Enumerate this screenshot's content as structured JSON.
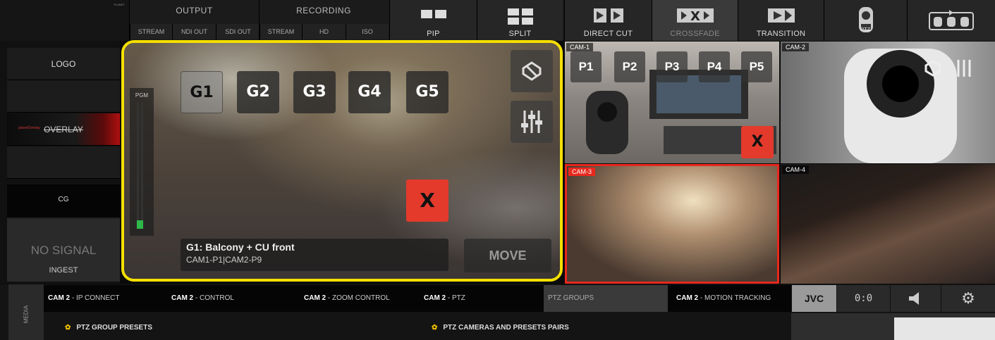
{
  "topbar": {
    "brand": "PLANET",
    "output": {
      "title": "OUTPUT",
      "buttons": [
        "STREAM",
        "NDI OUT",
        "SDI OUT"
      ]
    },
    "recording": {
      "title": "RECORDING",
      "buttons": [
        "STREAM",
        "HD",
        "ISO"
      ]
    },
    "modes": [
      {
        "label": "PIP",
        "icon": "pip-icon"
      },
      {
        "label": "SPLIT",
        "icon": "split-icon"
      },
      {
        "label": "DIRECT CUT",
        "icon": "direct-cut-icon"
      },
      {
        "label": "CROSSFADE",
        "icon": "crossfade-icon"
      },
      {
        "label": "TRANSITION",
        "icon": "transition-icon"
      },
      {
        "label": "PTZ",
        "icon": "ptz-icon"
      },
      {
        "label": "",
        "icon": "multi-ptz-icon"
      }
    ]
  },
  "sidebar": {
    "items": [
      "LOGO",
      "",
      "OVERLAY",
      "",
      "CG"
    ],
    "overlay_brand": "planetOverlay",
    "no_signal": "NO SIGNAL",
    "ingest": "INGEST"
  },
  "pgm": {
    "meter_label": "PGM",
    "groups": [
      "G1",
      "G2",
      "G3",
      "G4",
      "G5"
    ],
    "x_label": "X",
    "info_line1": "G1: Balcony + CU front",
    "info_line2": "CAM1-P1|CAM2-P9",
    "move_label": "MOVE"
  },
  "cameras": [
    {
      "tag": "CAM-1",
      "presets": [
        "P1",
        "P2",
        "P3",
        "P4",
        "P5"
      ],
      "x_label": "X"
    },
    {
      "tag": "CAM-2"
    },
    {
      "tag": "CAM-3"
    },
    {
      "tag": "CAM-4"
    }
  ],
  "bottom": {
    "media_label": "MEDIA",
    "tabs": [
      {
        "cam": "CAM 2",
        "text": " - IP CONNECT"
      },
      {
        "cam": "CAM 2",
        "text": " - CONTROL"
      },
      {
        "cam": "CAM 2",
        "text": " - ZOOM CONTROL"
      },
      {
        "cam": "CAM 2",
        "text": " - PTZ"
      },
      {
        "cam": "",
        "text": "PTZ GROUPS"
      },
      {
        "cam": "CAM 2",
        "text": " - MOTION TRACKING"
      }
    ],
    "presets_left": "PTZ GROUP PRESETS",
    "presets_right": "PTZ CAMERAS AND PRESETS PAIRS",
    "brand": "JVC",
    "counter": "0:0"
  },
  "colors": {
    "highlight": "#f5e000",
    "program_red": "#e8281e",
    "preset_gear": "#f5c400"
  }
}
